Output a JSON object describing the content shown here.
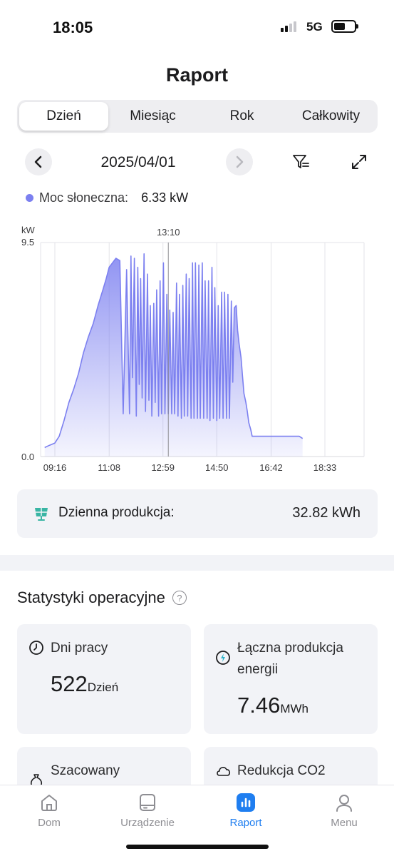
{
  "status": {
    "time": "18:05",
    "network": "5G"
  },
  "page": {
    "title": "Raport"
  },
  "tabs": [
    {
      "label": "Dzień",
      "active": true
    },
    {
      "label": "Miesiąc",
      "active": false
    },
    {
      "label": "Rok",
      "active": false
    },
    {
      "label": "Całkowity",
      "active": false
    }
  ],
  "date": {
    "value": "2025/04/01"
  },
  "legend": {
    "label": "Moc słoneczna:",
    "value": "6.33 kW",
    "color": "#7c80f0"
  },
  "chart_data": {
    "type": "area",
    "ylabel": "kW",
    "ylim": [
      0,
      9.5
    ],
    "yticks": [
      "0.0",
      "9.5"
    ],
    "xticks": [
      "09:16",
      "11:08",
      "12:59",
      "14:50",
      "16:42",
      "18:33"
    ],
    "cursor_label": "13:10",
    "series": [
      {
        "color": "#7c80f0",
        "x": [
          "08:55",
          "09:05",
          "09:16",
          "09:25",
          "09:35",
          "09:45",
          "09:55",
          "10:05",
          "10:15",
          "10:25",
          "10:35",
          "10:45",
          "10:55",
          "11:02",
          "11:08",
          "11:15",
          "11:22",
          "11:30",
          "11:37",
          "11:44",
          "11:50",
          "11:53",
          "11:56",
          "12:00",
          "12:04",
          "12:07",
          "12:10",
          "12:13",
          "12:16",
          "12:20",
          "12:23",
          "12:27",
          "12:30",
          "12:33",
          "12:36",
          "12:40",
          "12:43",
          "12:46",
          "12:50",
          "12:53",
          "12:56",
          "13:00",
          "13:03",
          "13:07",
          "13:10",
          "13:13",
          "13:17",
          "13:20",
          "13:23",
          "13:27",
          "13:30",
          "13:33",
          "13:37",
          "13:40",
          "13:43",
          "13:47",
          "13:50",
          "13:53",
          "13:57",
          "14:00",
          "14:03",
          "14:06",
          "14:10",
          "14:13",
          "14:16",
          "14:20",
          "14:23",
          "14:26",
          "14:30",
          "14:33",
          "14:36",
          "14:40",
          "14:43",
          "14:46",
          "14:50",
          "14:53",
          "14:56",
          "15:00",
          "15:03",
          "15:06",
          "15:10",
          "15:13",
          "15:16",
          "15:20",
          "15:23",
          "15:26",
          "15:30",
          "15:33",
          "15:36",
          "15:40",
          "15:43",
          "15:46",
          "15:50",
          "15:53",
          "15:56",
          "16:00",
          "16:03",
          "16:06",
          "16:10",
          "16:13",
          "16:20",
          "16:30",
          "16:40",
          "16:50",
          "17:00",
          "17:10",
          "17:20",
          "17:30",
          "17:40",
          "17:47"
        ],
        "y": [
          0.4,
          0.5,
          0.6,
          0.9,
          1.6,
          2.4,
          3.0,
          3.7,
          4.6,
          5.3,
          5.9,
          6.7,
          7.4,
          7.9,
          8.4,
          8.6,
          8.8,
          8.7,
          1.9,
          8.3,
          1.9,
          8.9,
          3.5,
          8.8,
          1.8,
          8.4,
          3.2,
          7.9,
          2.6,
          9.0,
          2.0,
          8.1,
          2.5,
          6.7,
          1.8,
          6.8,
          2.4,
          7.4,
          1.8,
          7.8,
          1.9,
          8.6,
          1.9,
          7.2,
          1.9,
          6.5,
          1.9,
          6.4,
          1.9,
          7.7,
          1.8,
          7.2,
          1.7,
          7.6,
          1.8,
          8.1,
          1.8,
          7.9,
          1.7,
          8.6,
          1.7,
          8.6,
          1.7,
          8.5,
          1.7,
          8.6,
          1.7,
          7.8,
          1.7,
          7.8,
          1.6,
          8.4,
          1.7,
          7.5,
          1.6,
          6.7,
          1.7,
          7.3,
          1.7,
          7.3,
          1.7,
          7.2,
          1.7,
          6.9,
          3.3,
          6.6,
          6.7,
          5.6,
          5.0,
          4.4,
          3.6,
          2.8,
          2.4,
          2.0,
          1.5,
          1.2,
          0.9,
          0.9,
          0.9,
          0.9,
          0.9,
          0.9,
          0.9,
          0.9,
          0.9,
          0.9,
          0.9,
          0.9,
          0.9,
          0.8
        ]
      }
    ]
  },
  "daily": {
    "label": "Dzienna produkcja:",
    "value": "32.82 kWh"
  },
  "ops": {
    "title": "Statystyki operacyjne",
    "help": "?",
    "cards": [
      {
        "label": "Dni pracy",
        "value": "522",
        "unit": "Dzień"
      },
      {
        "label": "Łączna produkcja",
        "label2": "energii",
        "value": "7.46",
        "unit": "MWh"
      },
      {
        "label": "Szacowany"
      },
      {
        "label": "Redukcja CO2"
      }
    ]
  },
  "tabbar": [
    {
      "label": "Dom",
      "icon": "house-icon"
    },
    {
      "label": "Urządzenie",
      "icon": "device-icon"
    },
    {
      "label": "Raport",
      "icon": "report-icon",
      "active": true
    },
    {
      "label": "Menu",
      "icon": "user-icon"
    }
  ],
  "colors": {
    "accent": "#1f7ef0",
    "chart": "#7c80f0"
  }
}
